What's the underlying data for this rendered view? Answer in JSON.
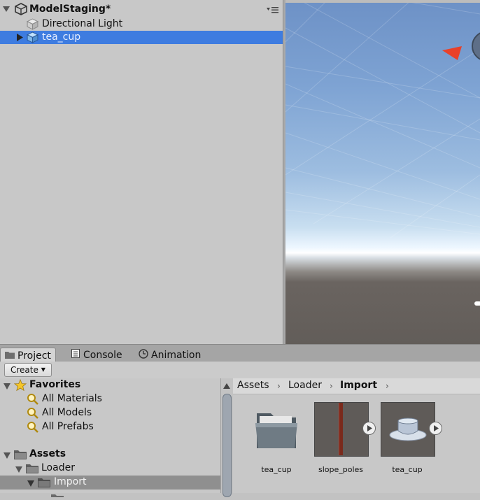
{
  "hierarchy": {
    "scene_name": "ModelStaging*",
    "items": [
      {
        "label": "Directional Light",
        "selected": false
      },
      {
        "label": "tea_cup",
        "selected": true
      }
    ]
  },
  "project": {
    "tabs": [
      {
        "label": "Project",
        "icon": "folder-icon",
        "active": true
      },
      {
        "label": "Console",
        "icon": "console-icon",
        "active": false
      },
      {
        "label": "Animation",
        "icon": "clock-icon",
        "active": false
      }
    ],
    "create_label": "Create",
    "favorites": {
      "label": "Favorites",
      "items": [
        "All Materials",
        "All Models",
        "All Prefabs"
      ]
    },
    "assets": {
      "label": "Assets",
      "children": [
        "Loader",
        "Import"
      ]
    },
    "breadcrumb": [
      "Assets",
      "Loader",
      "Import"
    ],
    "files": [
      {
        "name": "tea_cup",
        "type": "folder"
      },
      {
        "name": "slope_poles",
        "type": "model"
      },
      {
        "name": "tea_cup",
        "type": "model"
      }
    ]
  },
  "colors": {
    "selection": "#3e7ce0",
    "panel_bg": "#c8c8c8"
  }
}
